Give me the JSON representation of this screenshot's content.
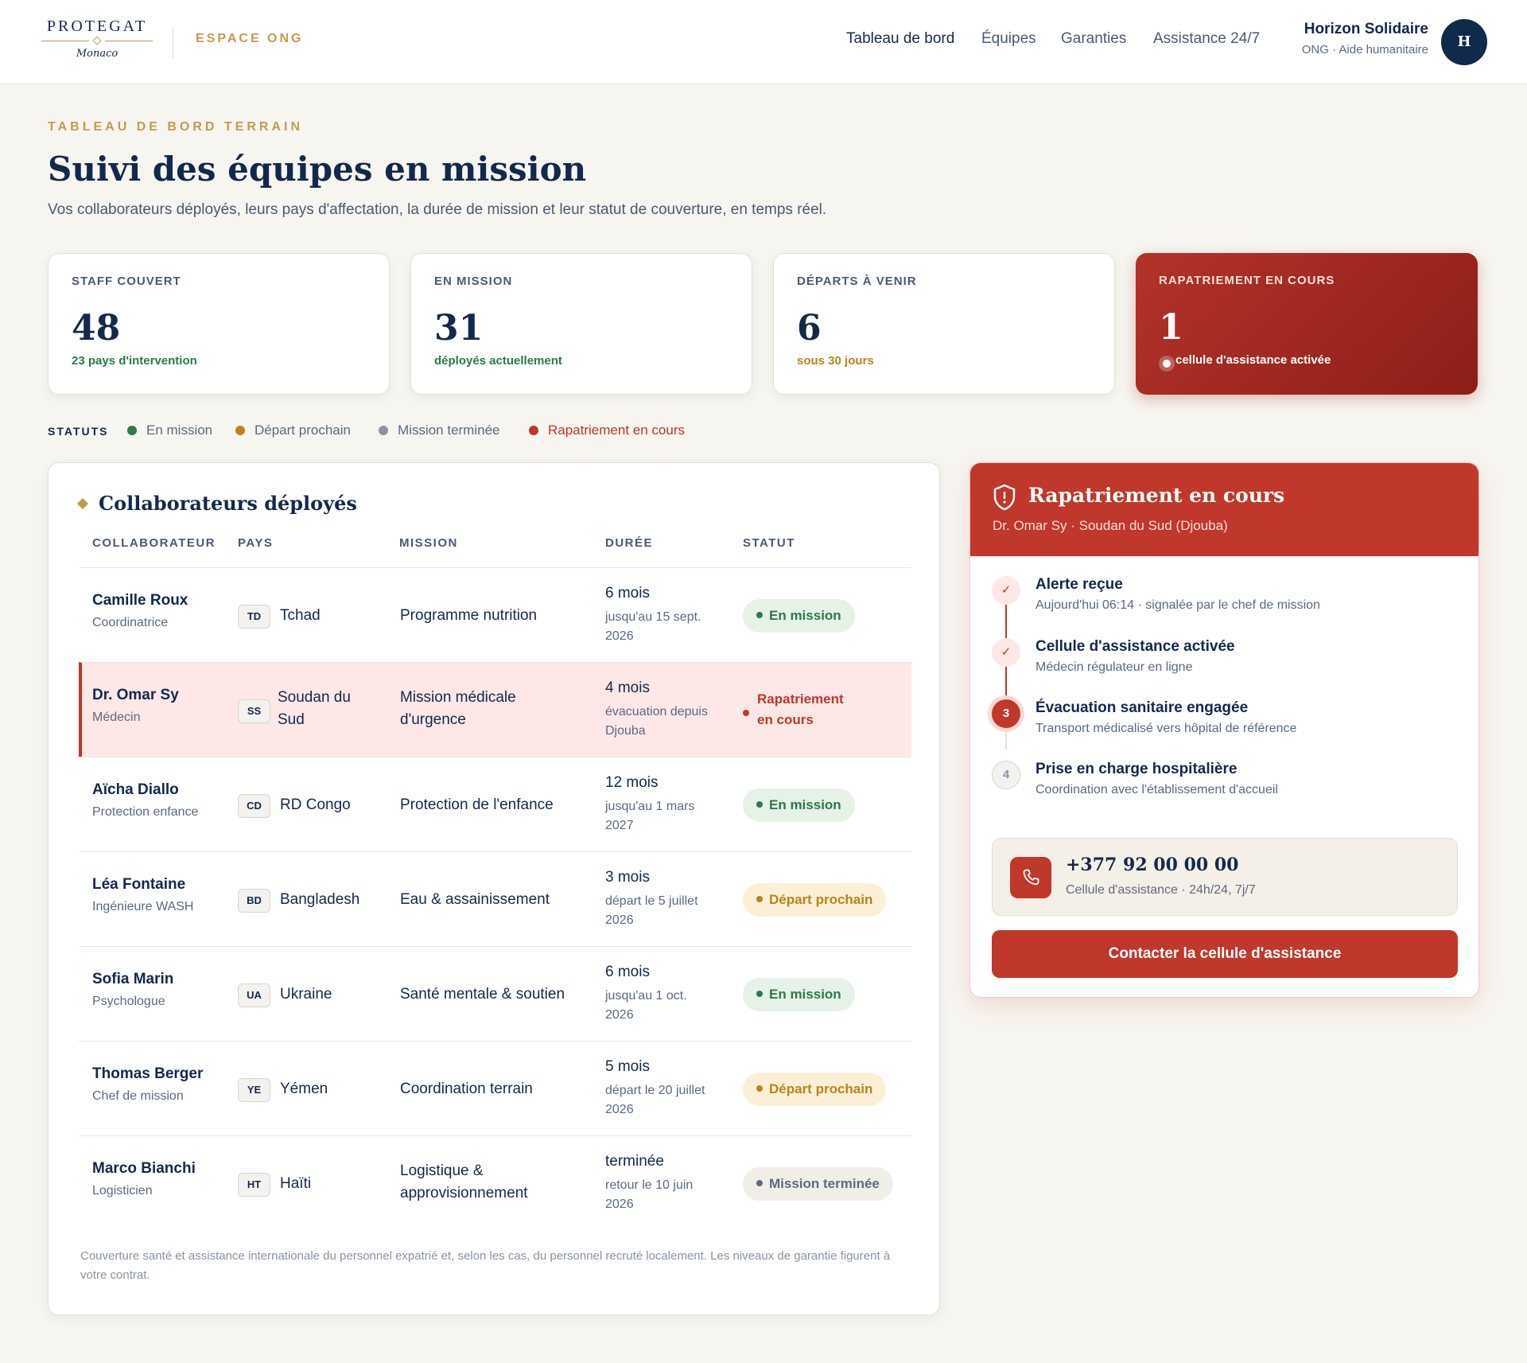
{
  "brand": {
    "logo_text": "PROTEGAT",
    "logo_sub": "Monaco",
    "space": "ESPACE ONG"
  },
  "nav": [
    "Tableau de bord",
    "Équipes",
    "Garanties",
    "Assistance 24/7"
  ],
  "user": {
    "name": "Horizon Solidaire",
    "subtitle": "ONG · Aide humanitaire",
    "initial": "H"
  },
  "page": {
    "eyebrow": "TABLEAU DE BORD TERRAIN",
    "title": "Suivi des équipes en mission",
    "subtitle": "Vos collaborateurs déployés, leurs pays d'affectation, la durée de mission et leur statut de couverture, en temps réel."
  },
  "stats": [
    {
      "label": "STAFF COUVERT",
      "value": "48",
      "sub": "23 pays d'intervention",
      "color": "#2c7a48"
    },
    {
      "label": "EN MISSION",
      "value": "31",
      "sub": "déployés actuellement",
      "color": "#2c7a48"
    },
    {
      "label": "DÉPARTS À VENIR",
      "value": "6",
      "sub": "sous 30 jours",
      "color": "#b7841d"
    },
    {
      "label": "RAPATRIEMENT EN COURS",
      "value": "1",
      "sub": "cellule d'assistance activée",
      "color": "#ffffff"
    }
  ],
  "legend": {
    "title": "STATUTS",
    "items": [
      {
        "label": "En mission",
        "color": "#2c7a48"
      },
      {
        "label": "Départ prochain",
        "color": "#b7841d"
      },
      {
        "label": "Mission terminée",
        "color": "#8a93a3"
      },
      {
        "label": "Rapatriement en cours",
        "color": "#c0372b"
      }
    ]
  },
  "table": {
    "title": "Collaborateurs déployés",
    "headers": [
      "COLLABORATEUR",
      "PAYS",
      "MISSION",
      "DURÉE",
      "STATUT"
    ],
    "rows": [
      {
        "name": "Camille Roux",
        "role": "Coordinatrice",
        "code": "TD",
        "country": "Tchad",
        "mission": "Programme nutrition",
        "duration": "6 mois",
        "duration_detail": "jusqu'au 15 sept. 2026",
        "status": "En mission"
      },
      {
        "name": "Dr. Omar Sy",
        "role": "Médecin",
        "code": "SS",
        "country": "Soudan du Sud",
        "mission": "Mission médicale d'urgence",
        "duration": "4 mois",
        "duration_detail": "évacuation depuis Djouba",
        "status": "Rapatriement en cours"
      },
      {
        "name": "Aïcha Diallo",
        "role": "Protection enfance",
        "code": "CD",
        "country": "RD Congo",
        "mission": "Protection de l'enfance",
        "duration": "12 mois",
        "duration_detail": "jusqu'au 1 mars 2027",
        "status": "En mission"
      },
      {
        "name": "Léa Fontaine",
        "role": "Ingénieure WASH",
        "code": "BD",
        "country": "Bangladesh",
        "mission": "Eau & assainissement",
        "duration": "3 mois",
        "duration_detail": "départ le 5 juillet 2026",
        "status": "Départ prochain"
      },
      {
        "name": "Sofia Marin",
        "role": "Psychologue",
        "code": "UA",
        "country": "Ukraine",
        "mission": "Santé mentale & soutien",
        "duration": "6 mois",
        "duration_detail": "jusqu'au 1 oct. 2026",
        "status": "En mission"
      },
      {
        "name": "Thomas Berger",
        "role": "Chef de mission",
        "code": "YE",
        "country": "Yémen",
        "mission": "Coordination terrain",
        "duration": "5 mois",
        "duration_detail": "départ le 20 juillet 2026",
        "status": "Départ prochain"
      },
      {
        "name": "Marco Bianchi",
        "role": "Logisticien",
        "code": "HT",
        "country": "Haïti",
        "mission": "Logistique & approvisionnement",
        "duration": "terminée",
        "duration_detail": "retour le 10 juin 2026",
        "status": "Mission terminée"
      }
    ],
    "footnote": "Couverture santé et assistance internationale du personnel expatrié et, selon les cas, du personnel recruté localement. Les niveaux de garantie figurent à votre contrat."
  },
  "repatriation": {
    "title": "Rapatriement en cours",
    "subtitle": "Dr. Omar Sy · Soudan du Sud (Djouba)",
    "steps": [
      {
        "marker": "✓",
        "title": "Alerte reçue",
        "desc": "Aujourd'hui 06:14 · signalée par le chef de mission",
        "state": "done"
      },
      {
        "marker": "✓",
        "title": "Cellule d'assistance activée",
        "desc": "Médecin régulateur en ligne",
        "state": "done"
      },
      {
        "marker": "3",
        "title": "Évacuation sanitaire engagée",
        "desc": "Transport médicalisé vers hôpital de référence",
        "state": "active"
      },
      {
        "marker": "4",
        "title": "Prise en charge hospitalière",
        "desc": "Coordination avec l'établissement d'accueil",
        "state": "todo"
      }
    ],
    "phone": "+377 92 00 00 00",
    "phone_sub": "Cellule d'assistance · 24h/24, 7j/7",
    "cta": "Contacter la cellule d'assistance"
  },
  "icons": {
    "shield": "shield-icon",
    "phone": "phone-icon",
    "check": "check-icon"
  }
}
